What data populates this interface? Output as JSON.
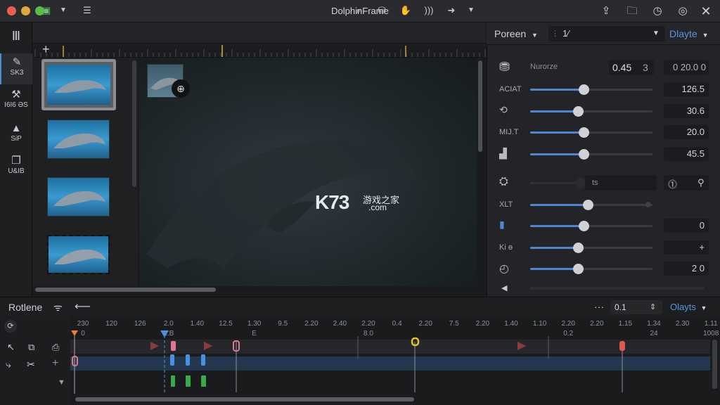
{
  "window": {
    "title": "DolphinFrame"
  },
  "colors": {
    "accent": "#4d86d1",
    "close": "#ec5f57",
    "minimize": "#e0a93b",
    "maximize": "#57bf45",
    "kf_pink": "#e0778f",
    "kf_blue": "#4c8fe0",
    "kf_green": "#3aa84b",
    "kf_yellow": "#e5c12b",
    "kf_red": "#e0584d",
    "kf_orange": "#f07a34"
  },
  "titlebar_icons": [
    "export-icon",
    "folder-icon",
    "history-icon",
    "help-icon",
    "close-icon"
  ],
  "rail": {
    "items": [
      {
        "icon": "bars-icon",
        "label": ""
      },
      {
        "icon": "brush-icon",
        "label": "SK3"
      },
      {
        "icon": "tools-icon",
        "label": "I6I6 ƏS"
      },
      {
        "icon": "layers-icon",
        "label": "SiP"
      },
      {
        "icon": "copy-icon",
        "label": "U&IB"
      }
    ]
  },
  "toolbar": {
    "left_icons": [
      "save-icon",
      "chevron-down-icon",
      "list-icon"
    ],
    "right_icons": [
      "search-icon",
      "stamp-icon",
      "hand-icon",
      "sound-icon",
      "forward-icon",
      "chevron-down-icon"
    ]
  },
  "canvas": {
    "watermark_main": "K73",
    "watermark_cn": "游戏之家",
    "watermark_sub": ".com"
  },
  "panel": {
    "mode_label": "Poreen",
    "field_value": "1⁄",
    "layer_label": "Dlayte",
    "header_name": "Nurorze",
    "header_value": "0.45",
    "header_count": "3",
    "header_time": "0 20.0 0",
    "sliders": [
      {
        "label": "ACIAT",
        "value": "126.5",
        "fill": 0.44
      },
      {
        "label": "",
        "value": "30.6",
        "fill": 0.4
      },
      {
        "label": "MIJ.T",
        "value": "20.0",
        "fill": 0.44
      },
      {
        "label": "",
        "value": "45.5",
        "fill": 0.44
      }
    ],
    "mid_field": "ts",
    "sliders2": [
      {
        "label": "XLT",
        "value": "",
        "fill": 0.47
      },
      {
        "label": "",
        "value": "0",
        "fill": 0.44
      },
      {
        "label": "Ki ɵ",
        "value": "+",
        "fill": 0.4
      },
      {
        "label": "",
        "value": "2 0",
        "fill": 0.4
      }
    ]
  },
  "timeline": {
    "title": "Rotlene",
    "zoom_value": "0.1",
    "layer_dropdown": "Olayts",
    "ticks": [
      "230",
      "120",
      "126",
      "2.0",
      "1.40",
      "12.5",
      "1.30",
      "9.5",
      "2.20",
      "2.40",
      "2.20",
      "0.4",
      "2.20",
      "7.5",
      "2.20",
      "1.40",
      "1.10",
      "2.20",
      "2.20",
      "1.15",
      "1.34",
      "2.30",
      "1.11"
    ],
    "sub_ticks": [
      "0",
      "",
      "",
      "1.B",
      "",
      "",
      "E",
      "",
      "",
      "",
      "8.0",
      "",
      "",
      "",
      "",
      "",
      "",
      "0.2",
      "",
      "",
      "24",
      "",
      "1008"
    ]
  }
}
